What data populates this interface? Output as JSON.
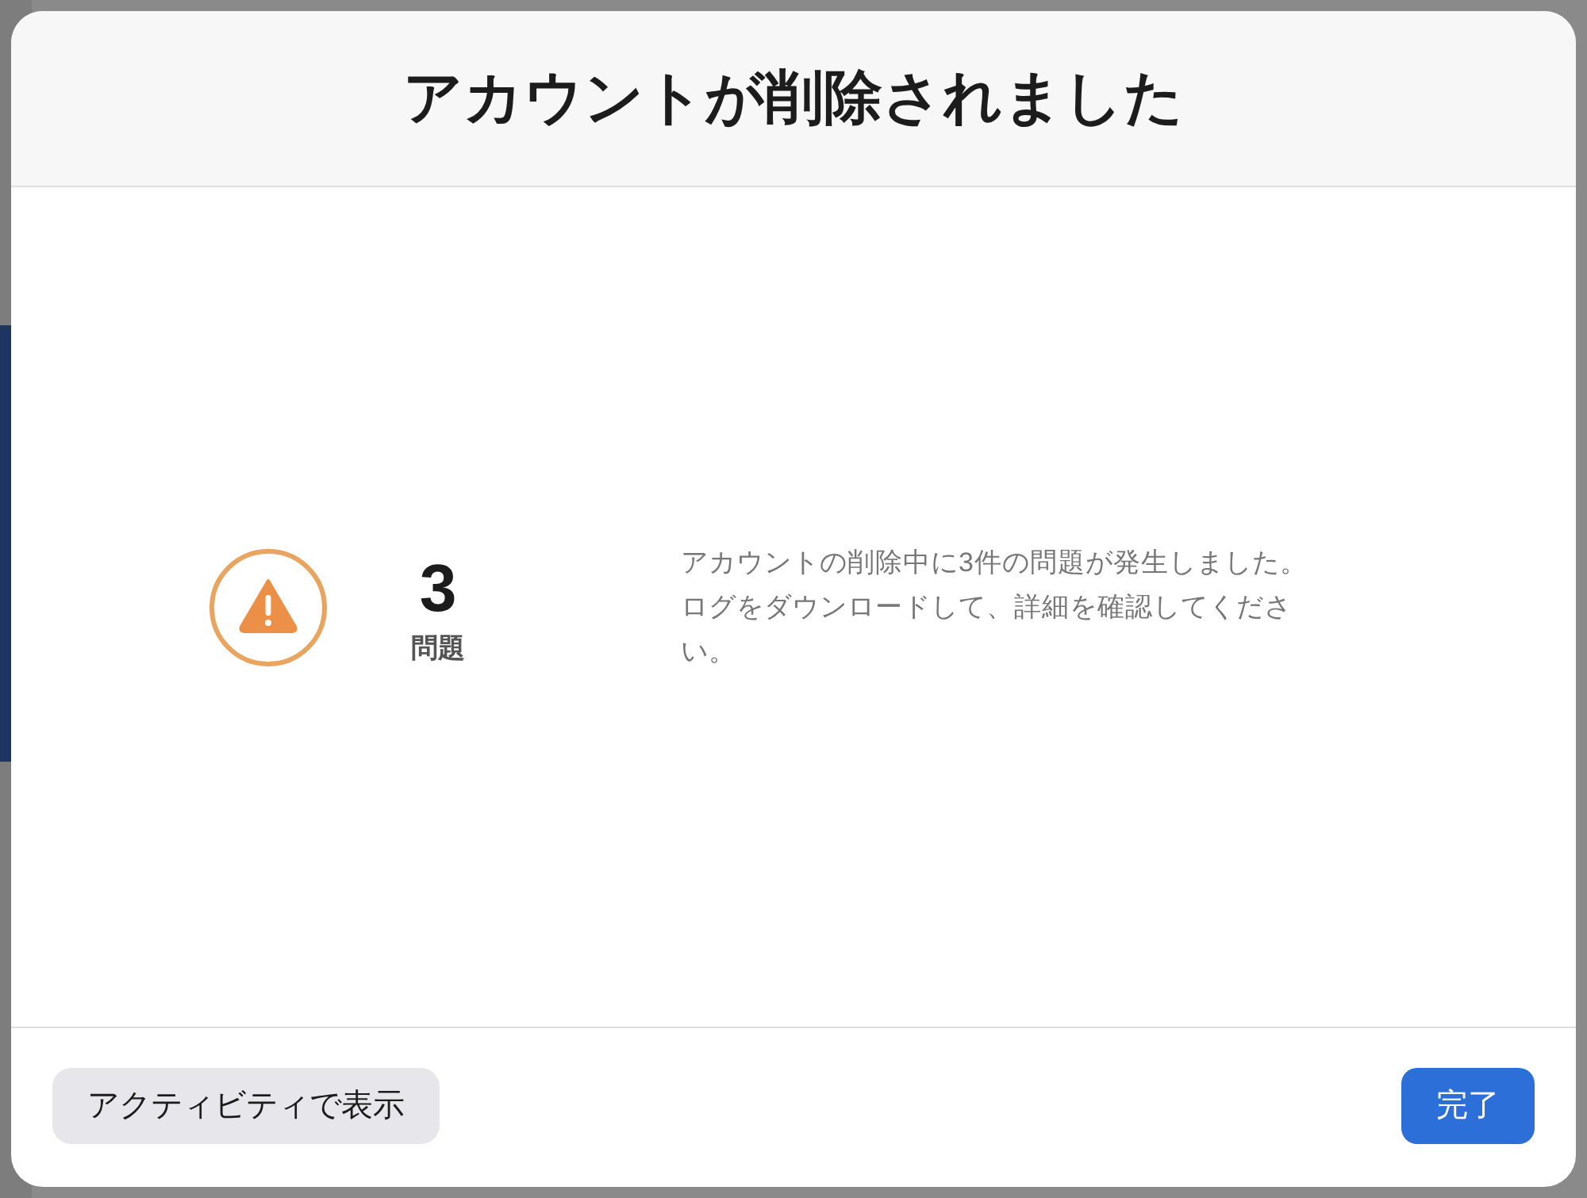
{
  "dialog": {
    "title": "アカウントが削除されました",
    "issue_count": "3",
    "issue_label": "問題",
    "message": "アカウントの削除中に3件の問題が発生しました。ログをダウンロードして、詳細を確認してください。",
    "buttons": [
      {
        "label": "アクティビティで表示",
        "kind": "secondary"
      },
      {
        "label": "完了",
        "kind": "primary"
      }
    ]
  }
}
